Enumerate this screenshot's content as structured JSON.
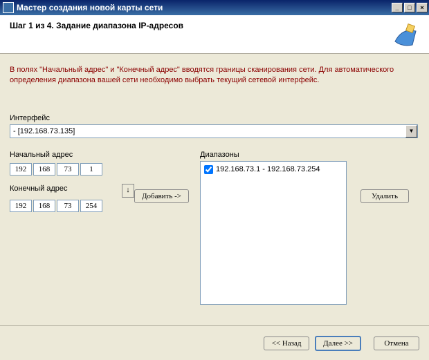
{
  "window": {
    "title": "Мастер создания новой карты сети"
  },
  "header": {
    "step_title": "Шаг 1 из 4. Задание диапазона IP-адресов"
  },
  "help_text": "В полях \"Начальный адрес\" и \"Конечный адрес\" вводятся границы сканирования сети. Для автоматического определения диапазона вашей сети необходимо выбрать текущий сетевой интерфейс.",
  "interface": {
    "label": "Интерфейс",
    "selected": " - [192.168.73.135]"
  },
  "start_addr": {
    "label": "Начальный адрес",
    "o1": "192",
    "o2": "168",
    "o3": "73",
    "o4": "1"
  },
  "end_addr": {
    "label": "Конечный адрес",
    "o1": "192",
    "o2": "168",
    "o3": "73",
    "o4": "254"
  },
  "buttons": {
    "add": "Добавить ->",
    "delete": "Удалить",
    "back": "<< Назад",
    "next": "Далее >>",
    "cancel": "Отмена",
    "down_arrow": "↓"
  },
  "ranges": {
    "label": "Диапазоны",
    "items": [
      {
        "text": "192.168.73.1 - 192.168.73.254",
        "checked": true
      }
    ]
  }
}
